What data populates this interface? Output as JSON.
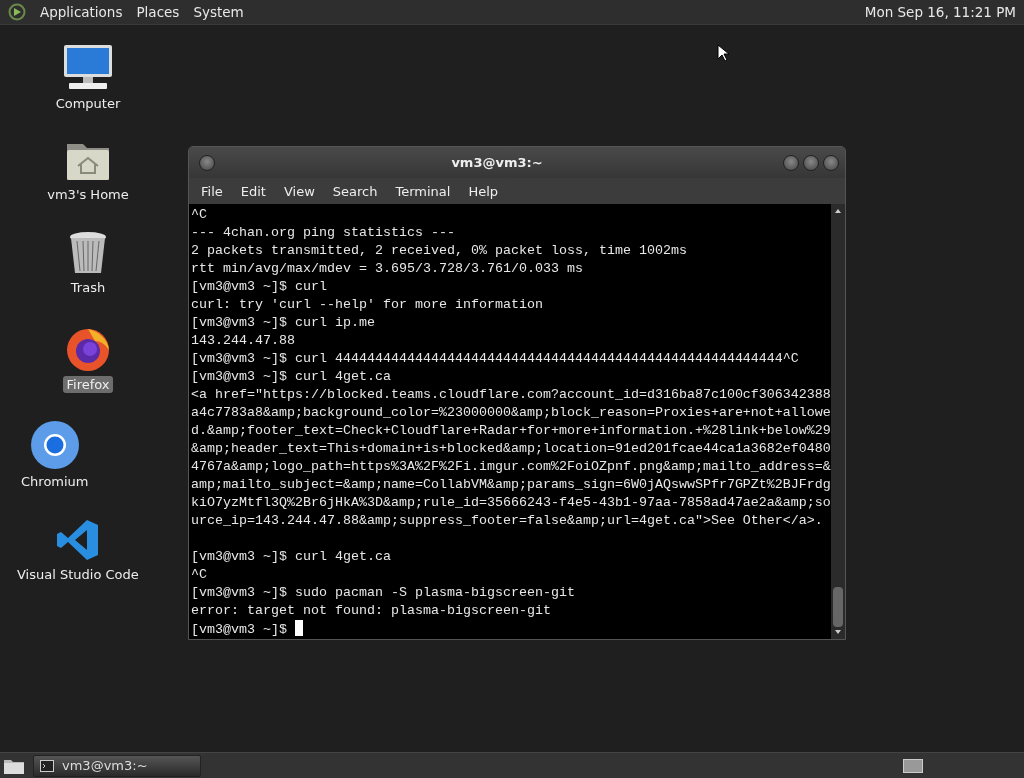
{
  "top_panel": {
    "menus": [
      "Applications",
      "Places",
      "System"
    ],
    "clock": "Mon Sep 16, 11:21 PM"
  },
  "desktop_icons": [
    {
      "kind": "computer",
      "label": "Computer",
      "selected": false
    },
    {
      "kind": "home",
      "label": "vm3's Home",
      "selected": false
    },
    {
      "kind": "trash",
      "label": "Trash",
      "selected": false
    },
    {
      "kind": "firefox",
      "label": "Firefox",
      "selected": true
    },
    {
      "kind": "chromium",
      "label": "Chromium",
      "selected": false
    },
    {
      "kind": "vscode",
      "label": "Visual Studio Code",
      "selected": false
    }
  ],
  "terminal": {
    "title": "vm3@vm3:~",
    "menu": [
      "File",
      "Edit",
      "View",
      "Search",
      "Terminal",
      "Help"
    ],
    "lines": [
      {
        "kind": "text",
        "text": "^C"
      },
      {
        "kind": "text",
        "text": "--- 4chan.org ping statistics ---"
      },
      {
        "kind": "text",
        "text": "2 packets transmitted, 2 received, 0% packet loss, time 1002ms"
      },
      {
        "kind": "text",
        "text": "rtt min/avg/max/mdev = 3.695/3.728/3.761/0.033 ms"
      },
      {
        "kind": "text",
        "text": "[vm3@vm3 ~]$ curl"
      },
      {
        "kind": "text",
        "text": "curl: try 'curl --help' for more information"
      },
      {
        "kind": "text",
        "text": "[vm3@vm3 ~]$ curl ip.me"
      },
      {
        "kind": "text",
        "text": "143.244.47.88"
      },
      {
        "kind": "text",
        "text": "[vm3@vm3 ~]$ curl 44444444444444444444444444444444444444444444444444444444^C"
      },
      {
        "kind": "text",
        "text": "[vm3@vm3 ~]$ curl 4get.ca"
      },
      {
        "kind": "text",
        "text": "<a href=\"https://blocked.teams.cloudflare.com?account_id=d316ba87c100cf306342388"
      },
      {
        "kind": "text",
        "text": "a4c7783a8&amp;background_color=%23000000&amp;block_reason=Proxies+are+not+allowe"
      },
      {
        "kind": "text",
        "text": "d.&amp;footer_text=Check+Cloudflare+Radar+for+more+information.+%28link+below%29"
      },
      {
        "kind": "text",
        "text": "&amp;header_text=This+domain+is+blocked&amp;location=91ed201fcae44ca1a3682ef0480"
      },
      {
        "kind": "text",
        "text": "4767a&amp;logo_path=https%3A%2F%2Fi.imgur.com%2FoiOZpnf.png&amp;mailto_address=&"
      },
      {
        "kind": "text",
        "text": "amp;mailto_subject=&amp;name=CollabVM&amp;params_sign=6W0jAQswwSPfr7GPZt%2BJFrdg"
      },
      {
        "kind": "text",
        "text": "kiO7yzMtfl3Q%2Br6jHkA%3D&amp;rule_id=35666243-f4e5-43b1-97aa-7858ad47ae2a&amp;so"
      },
      {
        "kind": "text",
        "text": "urce_ip=143.244.47.88&amp;suppress_footer=false&amp;url=4get.ca\">See Other</a>."
      },
      {
        "kind": "blank"
      },
      {
        "kind": "text",
        "text": "[vm3@vm3 ~]$ curl 4get.ca"
      },
      {
        "kind": "text",
        "text": "^C"
      },
      {
        "kind": "text",
        "text": "[vm3@vm3 ~]$ sudo pacman -S plasma-bigscreen-git"
      },
      {
        "kind": "text",
        "text": "error: target not found: plasma-bigscreen-git"
      },
      {
        "kind": "prompt",
        "text": "[vm3@vm3 ~]$"
      }
    ]
  },
  "taskbar": {
    "tasks": [
      {
        "label": "vm3@vm3:~",
        "selected": false
      }
    ]
  }
}
